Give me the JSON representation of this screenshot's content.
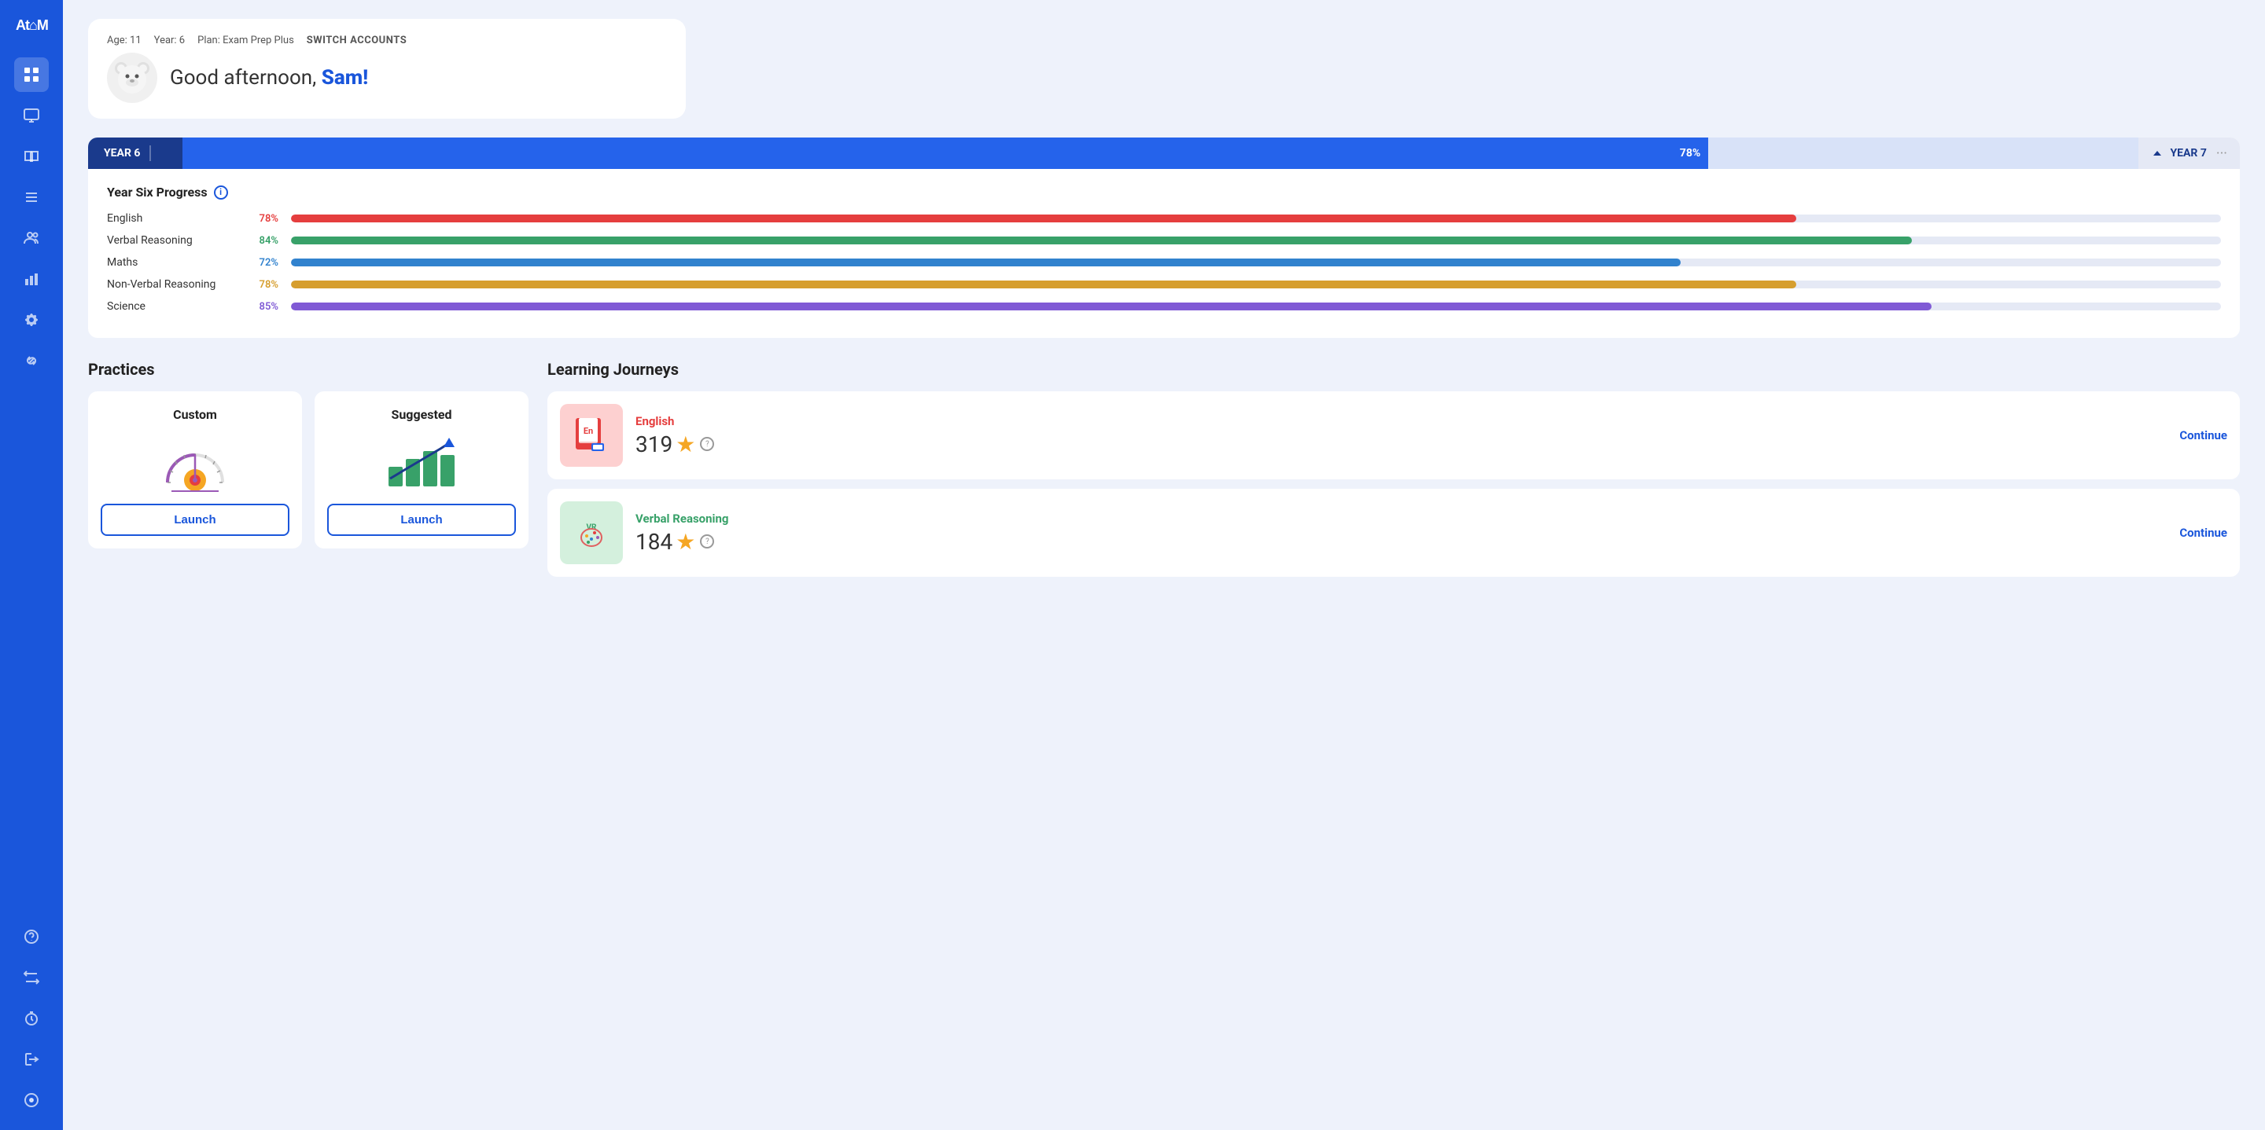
{
  "sidebar": {
    "logo": "At⌂M",
    "icons": [
      {
        "name": "grid-icon",
        "symbol": "⊞",
        "active": true
      },
      {
        "name": "monitor-icon",
        "symbol": "▭"
      },
      {
        "name": "book-icon",
        "symbol": "📖"
      },
      {
        "name": "list-icon",
        "symbol": "☰"
      },
      {
        "name": "users-icon",
        "symbol": "👥"
      },
      {
        "name": "chart-icon",
        "symbol": "📊"
      },
      {
        "name": "settings-icon",
        "symbol": "⚙"
      },
      {
        "name": "link-icon",
        "symbol": "🔗"
      },
      {
        "name": "help-icon",
        "symbol": "?"
      },
      {
        "name": "transfer-icon",
        "symbol": "⇄"
      },
      {
        "name": "clock-icon",
        "symbol": "⏱"
      },
      {
        "name": "exit-icon",
        "symbol": "↪"
      },
      {
        "name": "compass-icon",
        "symbol": "◎"
      }
    ]
  },
  "header": {
    "age": "Age: 11",
    "year": "Year: 6",
    "plan": "Plan: Exam Prep Plus",
    "switch_accounts": "SWITCH ACCOUNTS",
    "greeting": "Good afternoon, ",
    "name": "Sam!",
    "avatar": "🐻"
  },
  "progress": {
    "year_label": "YEAR 6",
    "year_percent": "78%",
    "year_bar_width": 78,
    "next_year_label": "YEAR 7",
    "title": "Year Six Progress",
    "subjects": [
      {
        "name": "English",
        "percent": "78%",
        "value": 78,
        "color": "#e53e3e"
      },
      {
        "name": "Verbal Reasoning",
        "percent": "84%",
        "value": 84,
        "color": "#38a169"
      },
      {
        "name": "Maths",
        "percent": "72%",
        "value": 72,
        "color": "#3182ce"
      },
      {
        "name": "Non-Verbal Reasoning",
        "percent": "78%",
        "value": 78,
        "color": "#d69e2e"
      },
      {
        "name": "Science",
        "percent": "85%",
        "value": 85,
        "color": "#805ad5"
      }
    ]
  },
  "practices": {
    "title": "Practices",
    "custom": {
      "label": "Custom",
      "launch": "Launch"
    },
    "suggested": {
      "label": "Suggested",
      "launch": "Launch"
    }
  },
  "journeys": {
    "title": "Learning Journeys",
    "items": [
      {
        "subject": "English",
        "subject_color": "#e53e3e",
        "thumb_bg": "#fdd0d0",
        "thumb_label": "En",
        "stars": "319",
        "continue": "Continue"
      },
      {
        "subject": "Verbal Reasoning",
        "subject_color": "#38a169",
        "thumb_bg": "#d4f0dd",
        "thumb_label": "VR",
        "stars": "184",
        "continue": "Continue"
      }
    ]
  }
}
